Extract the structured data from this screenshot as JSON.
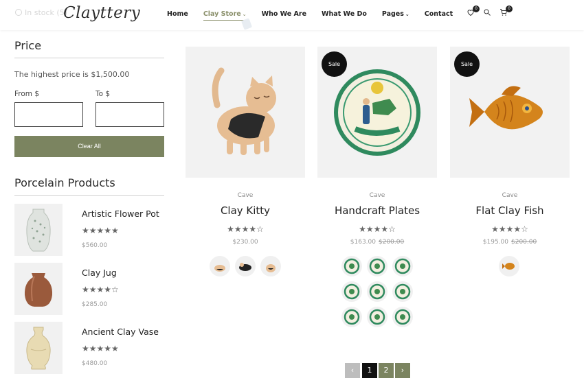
{
  "header": {
    "ghost_text": "In stock (5)",
    "logo": "Clayttery",
    "nav": [
      {
        "label": "Home",
        "active": false,
        "dropdown": false
      },
      {
        "label": "Clay Store",
        "active": true,
        "dropdown": true
      },
      {
        "label": "Who We Are",
        "active": false,
        "dropdown": false
      },
      {
        "label": "What We Do",
        "active": false,
        "dropdown": false
      },
      {
        "label": "Pages",
        "active": false,
        "dropdown": true
      },
      {
        "label": "Contact",
        "active": false,
        "dropdown": false
      }
    ],
    "wishlist_count": "0",
    "cart_count": "0",
    "icons": [
      "heart-icon",
      "search-icon",
      "cart-icon"
    ]
  },
  "price_filter": {
    "title": "Price",
    "note": "The highest price is $1,500.00",
    "from_label": "From $",
    "to_label": "To $",
    "from_value": "",
    "to_value": "",
    "clear_label": "Clear All"
  },
  "porcelain": {
    "title": "Porcelain Products",
    "items": [
      {
        "name": "Artistic Flower Pot",
        "rating": 5,
        "stars": "★★★★★",
        "price": "$560.00"
      },
      {
        "name": "Clay Jug",
        "rating": 4,
        "stars": "★★★★☆",
        "price": "$285.00"
      },
      {
        "name": "Ancient Clay Vase",
        "rating": 5,
        "stars": "★★★★★",
        "price": "$480.00"
      }
    ]
  },
  "products": [
    {
      "category": "Cave",
      "name": "Clay Kitty",
      "rating": 4,
      "stars": "★★★★☆",
      "price": "$230.00",
      "old_price": "",
      "sale": false,
      "swatch_count": 3
    },
    {
      "category": "Cave",
      "name": "Handcraft Plates",
      "rating": 4,
      "stars": "★★★★☆",
      "price": "$163.00",
      "old_price": "$200.00",
      "sale": true,
      "sale_label": "Sale",
      "swatch_count": 9
    },
    {
      "category": "Cave",
      "name": "Flat Clay Fish",
      "rating": 4,
      "stars": "★★★★☆",
      "price": "$195.00",
      "old_price": "$200.00",
      "sale": true,
      "sale_label": "Sale",
      "swatch_count": 1
    }
  ],
  "pagination": {
    "prev": "‹",
    "pages": [
      "1",
      "2"
    ],
    "current": "1",
    "next": "›"
  },
  "colors": {
    "accent": "#7b8460",
    "nav_active": "#8a8f6a"
  }
}
